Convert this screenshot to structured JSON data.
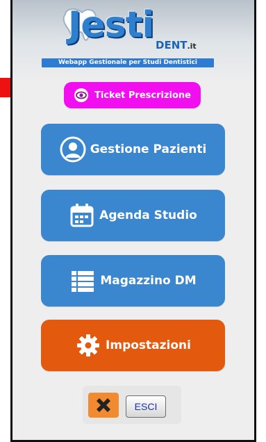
{
  "brand": {
    "logo_word": "Jesti",
    "logo_sub": "DENT",
    "logo_tld": ".it",
    "tagline": "Webapp Gestionale per Studi Dentistici"
  },
  "menu": {
    "ticket_label": "Ticket Prescrizione",
    "items": [
      {
        "label": "Gestione Pazienti",
        "color": "#3a86cf",
        "icon": "user-circle-icon"
      },
      {
        "label": "Agenda Studio",
        "color": "#3a86cf",
        "icon": "calendar-icon"
      },
      {
        "label": "Magazzino DM",
        "color": "#3a86cf",
        "icon": "list-icon"
      },
      {
        "label": "Impostazioni",
        "color": "#e35a0f",
        "icon": "gear-icon"
      }
    ]
  },
  "footer": {
    "logout_label": "ESCI"
  },
  "colors": {
    "accent_blue": "#3a86cf",
    "accent_orange": "#e35a0f",
    "ticket_magenta": "#f10ff0",
    "arrow_red": "#ee1111"
  }
}
